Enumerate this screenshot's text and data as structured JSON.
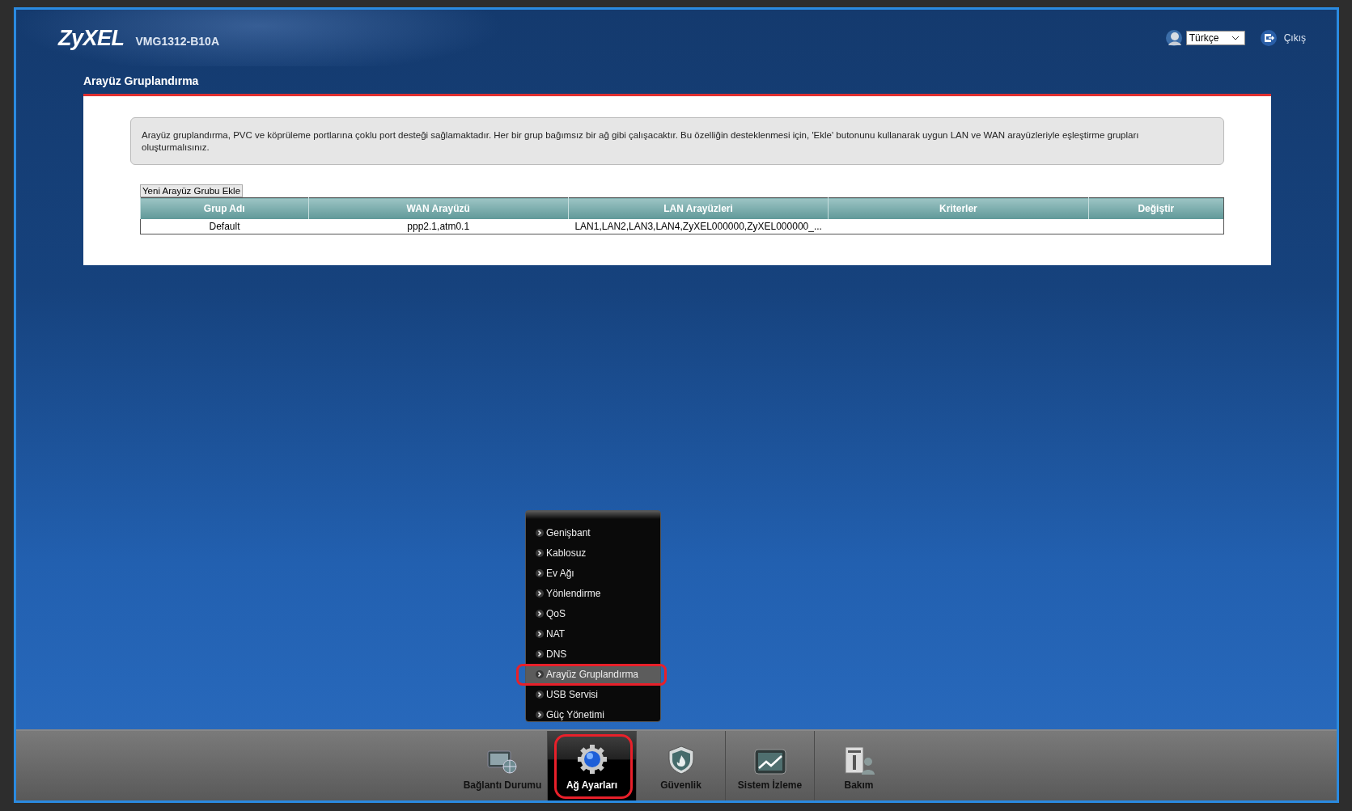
{
  "header": {
    "logo": "ZyXEL",
    "model": "VMG1312-B10A",
    "language": "Türkçe",
    "logout": "Çıkış"
  },
  "page_title": "Arayüz Gruplandırma",
  "info_text": "Arayüz gruplandırma, PVC ve köprüleme portlarına çoklu port desteği sağlamaktadır. Her bir grup bağımsız bir ağ gibi çalışacaktır. Bu özelliğin desteklenmesi için, 'Ekle' butonunu kullanarak uygun LAN ve WAN arayüzleriyle eşleştirme grupları oluşturmalısınız.",
  "add_button": "Yeni Arayüz Grubu Ekle",
  "table": {
    "columns": [
      "Grup Adı",
      "WAN Arayüzü",
      "LAN Arayüzleri",
      "Kriterler",
      "Değiştir"
    ],
    "rows": [
      {
        "cells": [
          "Default",
          "ppp2.1,atm0.1",
          "LAN1,LAN2,LAN3,LAN4,ZyXEL000000,ZyXEL000000_..."
        ]
      }
    ]
  },
  "submenu": [
    {
      "label": "Genişbant",
      "selected": false
    },
    {
      "label": "Kablosuz",
      "selected": false
    },
    {
      "label": "Ev Ağı",
      "selected": false
    },
    {
      "label": "Yönlendirme",
      "selected": false
    },
    {
      "label": "QoS",
      "selected": false
    },
    {
      "label": "NAT",
      "selected": false
    },
    {
      "label": "DNS",
      "selected": false
    },
    {
      "label": "Arayüz Gruplandırma",
      "selected": true
    },
    {
      "label": "USB Servisi",
      "selected": false
    },
    {
      "label": "Güç Yönetimi",
      "selected": false
    }
  ],
  "tabs": [
    {
      "label": "Bağlantı Durumu",
      "kind": "status",
      "selected": false
    },
    {
      "label": "Ağ Ayarları",
      "kind": "network",
      "selected": true
    },
    {
      "label": "Güvenlik",
      "kind": "security",
      "selected": false
    },
    {
      "label": "Sistem İzleme",
      "kind": "monitor",
      "selected": false
    },
    {
      "label": "Bakım",
      "kind": "maintenance",
      "selected": false
    }
  ]
}
